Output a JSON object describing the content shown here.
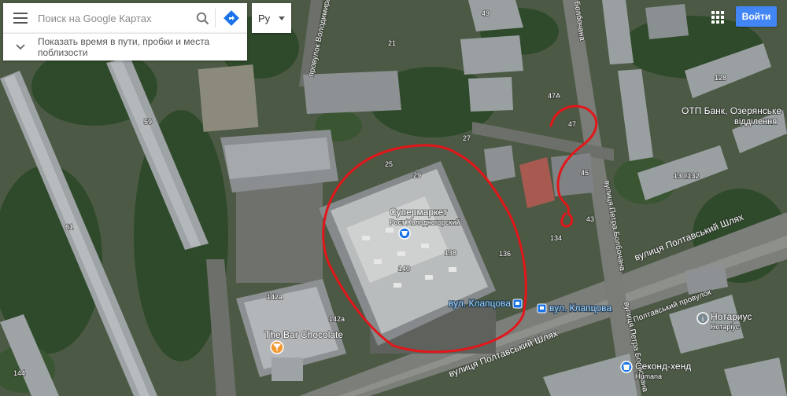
{
  "search": {
    "placeholder": "Поиск на Google Картах",
    "traffic_label": "Показать время в пути, пробки и места поблизости",
    "language": "Ру"
  },
  "header": {
    "signin_label": "Войти"
  },
  "map": {
    "house_numbers": {
      "n49": "49",
      "n21": "21",
      "n59": "59",
      "n61": "61",
      "n25": "25",
      "n29": "29",
      "n27": "27",
      "n47a": "47A",
      "n47": "47",
      "n45": "45",
      "n43": "43",
      "n134": "134",
      "n136": "136",
      "n138": "138",
      "n140": "140",
      "n142a1": "142a",
      "n142a2": "142a",
      "n128": "128",
      "n130": "130/132",
      "n144": "144"
    },
    "streets": {
      "voloshkova": "провулок Володимира Ус…",
      "bolbochana_top": "Болбочана",
      "bolbochana": "вулиця Петра Болбочана",
      "bolbochana_low": "вулиця Петра Болбочана",
      "poltavskyi_shliakh": "вулиця Полтавський Шлях",
      "poltavskyi_shliakh_low": "вулиця Полтавський Шлях",
      "poltavskyi_prov": "Полтавський провулок"
    },
    "places": {
      "supermarket_name": "Супермаркет",
      "supermarket_sub": "Рост Холодногорский",
      "otp_line1": "ОТП Банк, Озерянське",
      "otp_line2": "відділення",
      "bar": "The Bar Chocolate",
      "notary": "Нотариус",
      "notary_sub": "Нотаріус",
      "second": "Секонд-хенд",
      "humana": "Humana"
    },
    "transit": {
      "stop1": "вул. Клапцова",
      "stop2": "вул. Клапцова"
    },
    "colors": {
      "annotation": "#e3161a",
      "label_blue": "#1a73e8",
      "pin_orange": "#f29933"
    }
  }
}
